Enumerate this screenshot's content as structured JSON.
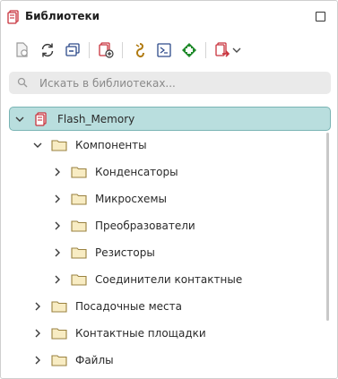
{
  "header": {
    "title": "Библиотеки"
  },
  "toolbar": {
    "buttons": [
      {
        "name": "open-library-icon"
      },
      {
        "name": "refresh-icon"
      },
      {
        "name": "collapse-all-icon"
      },
      {
        "name": "add-library-icon"
      },
      {
        "name": "component-icon"
      },
      {
        "name": "footprint-icon"
      },
      {
        "name": "pad-icon"
      },
      {
        "name": "export-icon"
      }
    ]
  },
  "search": {
    "placeholder": "Искать в библиотеках..."
  },
  "tree": {
    "root": "Flash_Memory",
    "components": "Компоненты",
    "children": [
      "Конденсаторы",
      "Микросхемы",
      "Преобразователи",
      "Резисторы",
      "Соединители контактные"
    ],
    "footprints": "Посадочные места",
    "pads": "Контактные площадки",
    "files": "Файлы"
  },
  "colors": {
    "selection_bg": "#b9dede",
    "selection_border": "#79b4b4",
    "library_red": "#c8323c",
    "folder_fill": "#f8ecc3",
    "folder_stroke": "#9a8240",
    "green_icon": "#1f8a2a",
    "amber_icon": "#b07a10"
  }
}
